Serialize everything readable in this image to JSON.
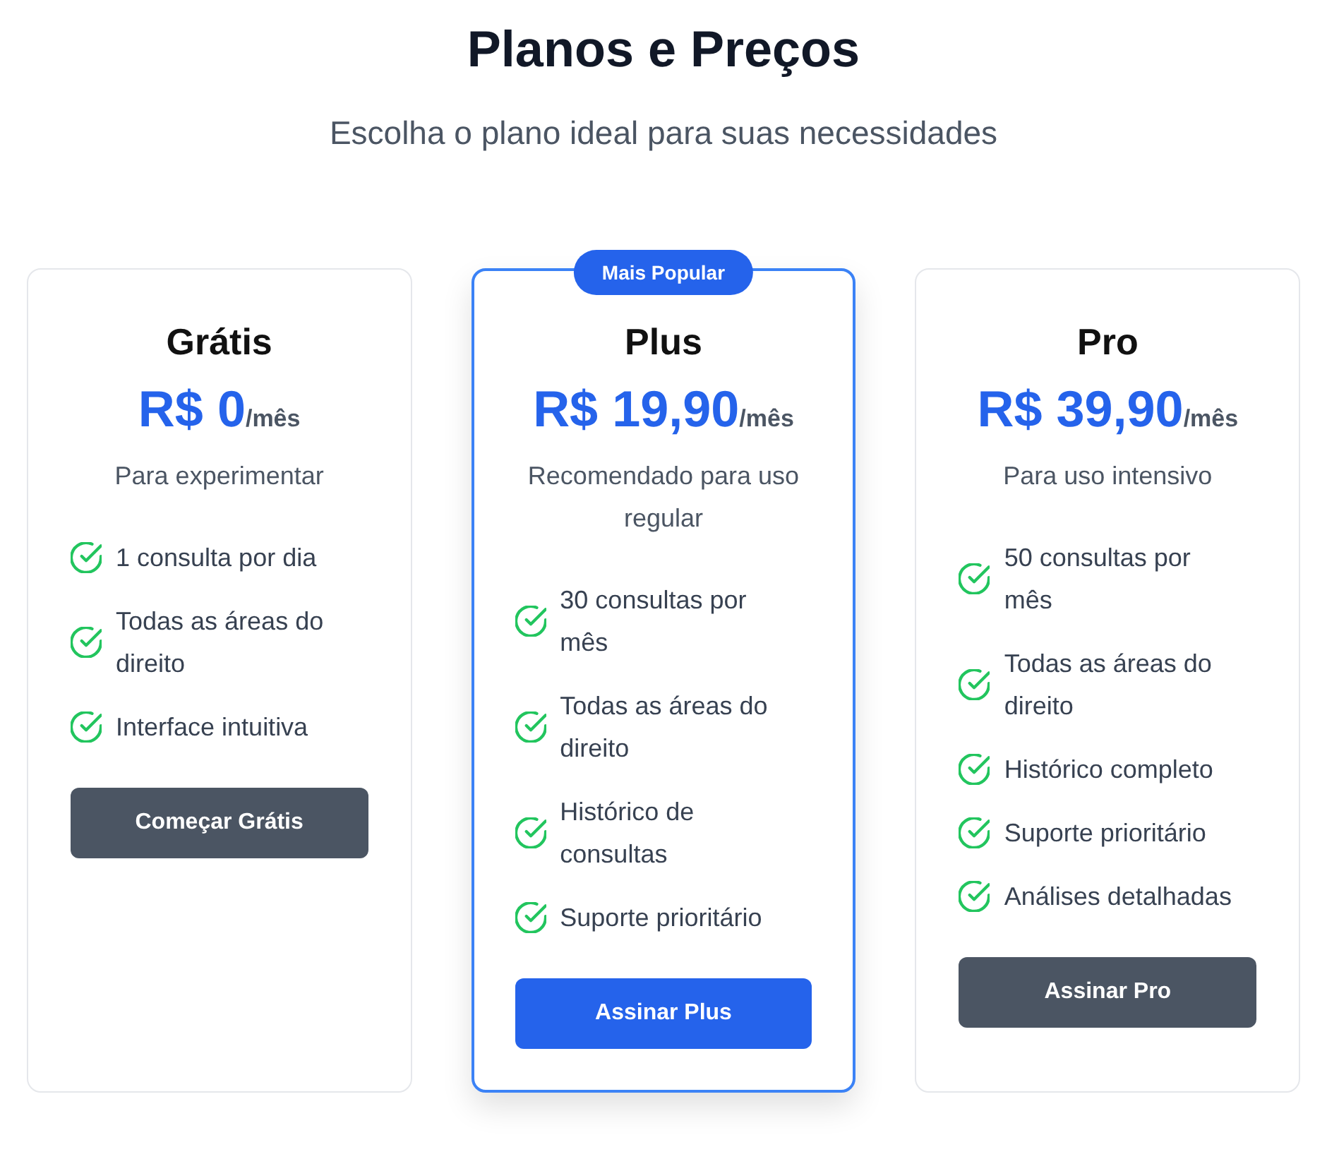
{
  "header": {
    "title": "Planos e Preços",
    "subtitle": "Escolha o plano ideal para suas necessidades"
  },
  "plans": [
    {
      "name": "Grátis",
      "price": "R$ 0",
      "period": "/mês",
      "description": "Para experimentar",
      "features": [
        "1 consulta por dia",
        "Todas as áreas do direito",
        "Interface intuitiva"
      ],
      "button": "Começar Grátis",
      "highlighted": false
    },
    {
      "badge": "Mais Popular",
      "name": "Plus",
      "price": "R$ 19,90",
      "period": "/mês",
      "description": "Recomendado para uso regular",
      "features": [
        "30 consultas por mês",
        "Todas as áreas do direito",
        "Histórico de consultas",
        "Suporte prioritário"
      ],
      "button": "Assinar Plus",
      "highlighted": true
    },
    {
      "name": "Pro",
      "price": "R$ 39,90",
      "period": "/mês",
      "description": "Para uso intensivo",
      "features": [
        "50 consultas por mês",
        "Todas as áreas do direito",
        "Histórico completo",
        "Suporte prioritário",
        "Análises detalhadas"
      ],
      "button": "Assinar Pro",
      "highlighted": false
    }
  ]
}
